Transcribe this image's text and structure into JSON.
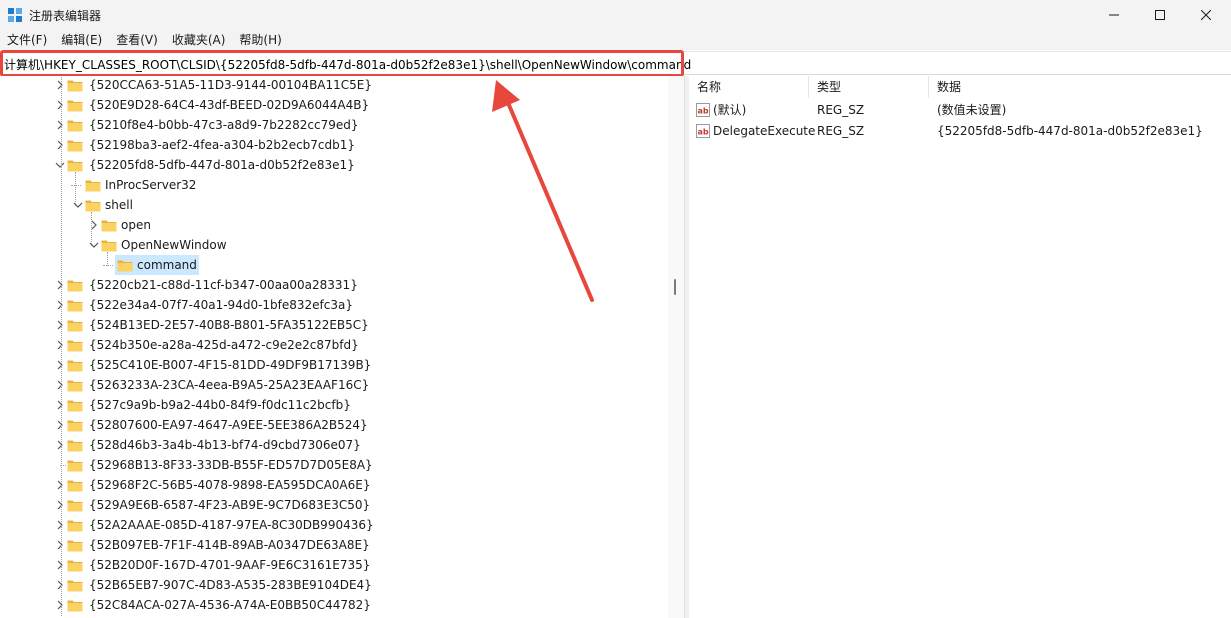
{
  "window": {
    "title": "注册表编辑器",
    "colors": {
      "titlebar": "#f3f3f3",
      "accent": "#1e7ad6",
      "highlight": "#e8473d",
      "selection": "#cce8ff"
    }
  },
  "menu": [
    "文件(F)",
    "编辑(E)",
    "查看(V)",
    "收藏夹(A)",
    "帮助(H)"
  ],
  "address": "计算机\\HKEY_CLASSES_ROOT\\CLSID\\{52205fd8-5dfb-447d-801a-d0b52f2e83e1}\\shell\\OpenNewWindow\\command",
  "tree": [
    {
      "label": "{520CCA63-51A5-11D3-9144-00104BA11C5E}",
      "expander": "collapsed",
      "level": 0
    },
    {
      "label": "{520E9D28-64C4-43df-BEED-02D9A6044A4B}",
      "expander": "collapsed",
      "level": 0
    },
    {
      "label": "{5210f8e4-b0bb-47c3-a8d9-7b2282cc79ed}",
      "expander": "collapsed",
      "level": 0
    },
    {
      "label": "{52198ba3-aef2-4fea-a304-b2b2ecb7cdb1}",
      "expander": "collapsed",
      "level": 0
    },
    {
      "label": "{52205fd8-5dfb-447d-801a-d0b52f2e83e1}",
      "expander": "expanded",
      "level": 0
    },
    {
      "label": "InProcServer32",
      "expander": "none",
      "level": 1
    },
    {
      "label": "shell",
      "expander": "expanded",
      "level": 1
    },
    {
      "label": "open",
      "expander": "collapsed",
      "level": 2
    },
    {
      "label": "OpenNewWindow",
      "expander": "expanded",
      "level": 2
    },
    {
      "label": "command",
      "expander": "none",
      "level": 3,
      "selected": true
    },
    {
      "label": "{5220cb21-c88d-11cf-b347-00aa00a28331}",
      "expander": "collapsed",
      "level": 0
    },
    {
      "label": "{522e34a4-07f7-40a1-94d0-1bfe832efc3a}",
      "expander": "collapsed",
      "level": 0
    },
    {
      "label": "{524B13ED-2E57-40B8-B801-5FA35122EB5C}",
      "expander": "collapsed",
      "level": 0
    },
    {
      "label": "{524b350e-a28a-425d-a472-c9e2e2c87bfd}",
      "expander": "collapsed",
      "level": 0
    },
    {
      "label": "{525C410E-B007-4F15-81DD-49DF9B17139B}",
      "expander": "collapsed",
      "level": 0
    },
    {
      "label": "{5263233A-23CA-4eea-B9A5-25A23EAAF16C}",
      "expander": "collapsed",
      "level": 0
    },
    {
      "label": "{527c9a9b-b9a2-44b0-84f9-f0dc11c2bcfb}",
      "expander": "collapsed",
      "level": 0
    },
    {
      "label": "{52807600-EA97-4647-A9EE-5EE386A2B524}",
      "expander": "collapsed",
      "level": 0
    },
    {
      "label": "{528d46b3-3a4b-4b13-bf74-d9cbd7306e07}",
      "expander": "collapsed",
      "level": 0
    },
    {
      "label": "{52968B13-8F33-33DB-B55F-ED57D7D05E8A}",
      "expander": "none",
      "level": 0
    },
    {
      "label": "{52968F2C-56B5-4078-9898-EA595DCA0A6E}",
      "expander": "collapsed",
      "level": 0
    },
    {
      "label": "{529A9E6B-6587-4F23-AB9E-9C7D683E3C50}",
      "expander": "collapsed",
      "level": 0
    },
    {
      "label": "{52A2AAAE-085D-4187-97EA-8C30DB990436}",
      "expander": "collapsed",
      "level": 0
    },
    {
      "label": "{52B097EB-7F1F-414B-89AB-A0347DE63A8E}",
      "expander": "collapsed",
      "level": 0
    },
    {
      "label": "{52B20D0F-167D-4701-9AAF-9E6C3161E735}",
      "expander": "collapsed",
      "level": 0
    },
    {
      "label": "{52B65EB7-907C-4D83-A535-283BE9104DE4}",
      "expander": "collapsed",
      "level": 0
    },
    {
      "label": "{52C84ACA-027A-4536-A74A-E0BB50C44782}",
      "expander": "collapsed",
      "level": 0
    }
  ],
  "list": {
    "columns": [
      "名称",
      "类型",
      "数据"
    ],
    "rows": [
      {
        "name": "(默认)",
        "type": "REG_SZ",
        "data": "(数值未设置)",
        "icon": "ab-string-icon"
      },
      {
        "name": "DelegateExecute",
        "type": "REG_SZ",
        "data": "{52205fd8-5dfb-447d-801a-d0b52f2e83e1}",
        "icon": "ab-string-icon"
      }
    ]
  }
}
